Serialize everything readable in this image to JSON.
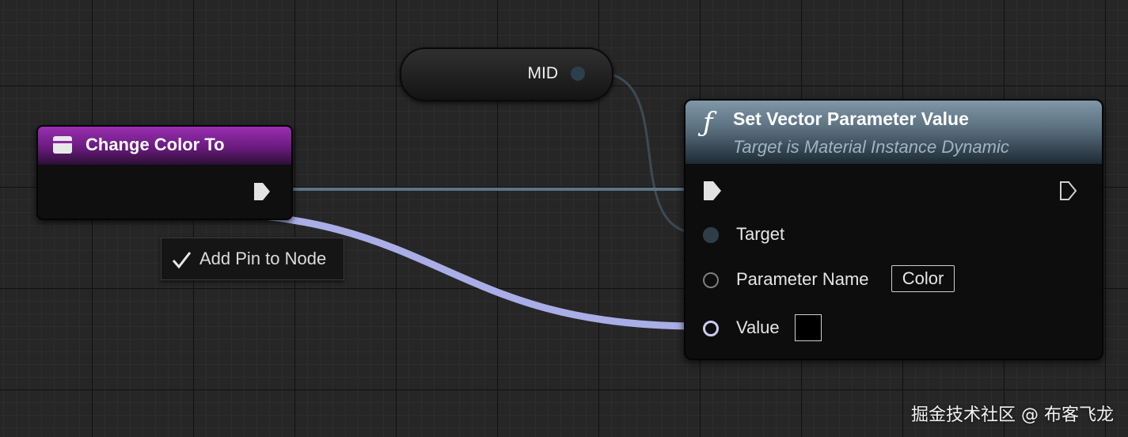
{
  "variable_node": {
    "label": "MID"
  },
  "event_node": {
    "title": "Change Color To"
  },
  "tooltip": {
    "label": "Add Pin to Node"
  },
  "function_node": {
    "title": "Set Vector Parameter Value",
    "subtitle": "Target is Material Instance Dynamic",
    "pins": {
      "target": "Target",
      "parameter_name": "Parameter Name",
      "parameter_value": "Color",
      "value": "Value"
    }
  },
  "watermark": "掘金技术社区 @ 布客飞龙",
  "colors": {
    "event_header": "#7b2392",
    "function_header": "#6b8394",
    "exec_wire": "#52707f",
    "vector_wire": "#a9aee6",
    "object_wire": "#3a4a55"
  }
}
